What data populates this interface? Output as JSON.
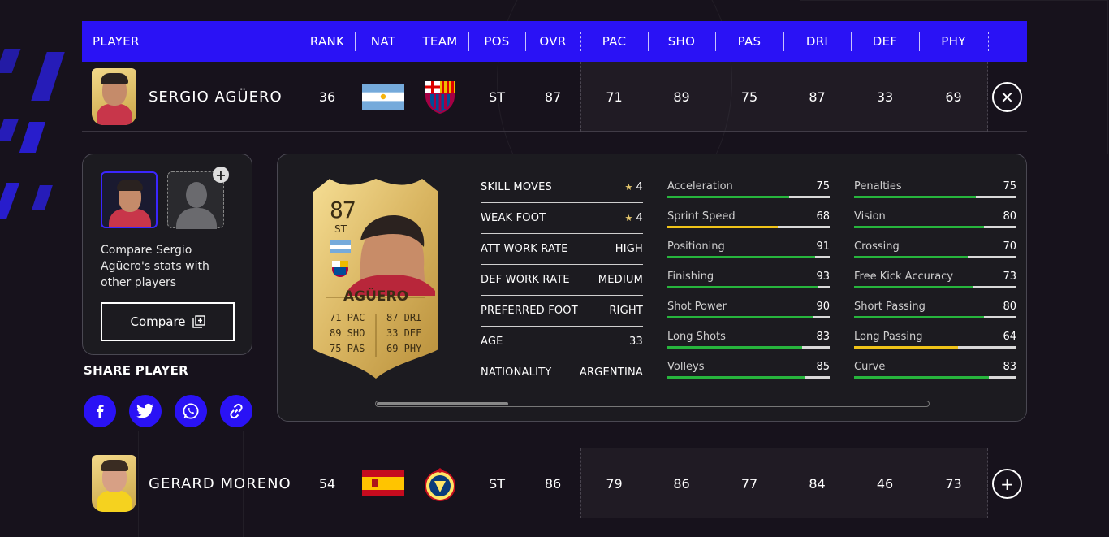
{
  "header": {
    "player": "PLAYER",
    "rank": "RANK",
    "nat": "NAT",
    "team": "TEAM",
    "pos": "POS",
    "ovr": "OVR",
    "pac": "PAC",
    "sho": "SHO",
    "pas": "PAS",
    "dri": "DRI",
    "def": "DEF",
    "phy": "PHY"
  },
  "players": [
    {
      "name": "SERGIO AGÜERO",
      "rank": "36",
      "pos": "ST",
      "ovr": "87",
      "pac": "71",
      "sho": "89",
      "pas": "75",
      "dri": "87",
      "def": "33",
      "phy": "69",
      "action_icon": "close-icon",
      "action_glyph": "✕"
    },
    {
      "name": "GERARD MORENO",
      "rank": "54",
      "pos": "ST",
      "ovr": "86",
      "pac": "79",
      "sho": "86",
      "pas": "77",
      "dri": "84",
      "def": "46",
      "phy": "73",
      "action_icon": "plus-icon",
      "action_glyph": "+"
    }
  ],
  "compare": {
    "text": "Compare Sergio Agüero's stats with other players",
    "button": "Compare"
  },
  "share": {
    "title": "SHARE PLAYER",
    "icons": [
      "facebook-icon",
      "twitter-icon",
      "whatsapp-icon",
      "link-icon"
    ]
  },
  "card": {
    "rating": "87",
    "position": "ST",
    "name": "AGÜERO",
    "stats_left": [
      "71 PAC",
      "89 SHO",
      "75 PAS"
    ],
    "stats_right": [
      "87 DRI",
      "33 DEF",
      "69 PHY"
    ]
  },
  "attributes": [
    {
      "label": "SKILL MOVES",
      "value": "4",
      "star": true
    },
    {
      "label": "WEAK FOOT",
      "value": "4",
      "star": true
    },
    {
      "label": "ATT WORK RATE",
      "value": "HIGH",
      "star": false
    },
    {
      "label": "DEF WORK RATE",
      "value": "MEDIUM",
      "star": false
    },
    {
      "label": "PREFERRED FOOT",
      "value": "RIGHT",
      "star": false
    },
    {
      "label": "AGE",
      "value": "33",
      "star": false
    },
    {
      "label": "NATIONALITY",
      "value": "ARGENTINA",
      "star": false
    }
  ],
  "stats_col1": [
    {
      "label": "Acceleration",
      "value": 75
    },
    {
      "label": "Sprint Speed",
      "value": 68
    },
    {
      "label": "Positioning",
      "value": 91
    },
    {
      "label": "Finishing",
      "value": 93
    },
    {
      "label": "Shot Power",
      "value": 90
    },
    {
      "label": "Long Shots",
      "value": 83
    },
    {
      "label": "Volleys",
      "value": 85
    }
  ],
  "stats_col2": [
    {
      "label": "Penalties",
      "value": 75
    },
    {
      "label": "Vision",
      "value": 80
    },
    {
      "label": "Crossing",
      "value": 70
    },
    {
      "label": "Free Kick Accuracy",
      "value": 73
    },
    {
      "label": "Short Passing",
      "value": 80
    },
    {
      "label": "Long Passing",
      "value": 64
    },
    {
      "label": "Curve",
      "value": 83
    }
  ],
  "colors": {
    "accent": "#2a12f5",
    "bar_high": "#27b53d",
    "bar_mid": "#f0c419"
  }
}
